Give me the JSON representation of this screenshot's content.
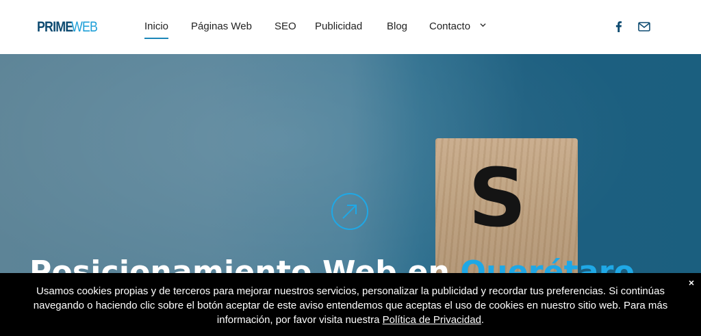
{
  "header": {
    "logo": {
      "prime": "PRIME",
      "web": "WEB"
    },
    "nav": [
      {
        "label": "Inicio",
        "active": true
      },
      {
        "label": "Páginas Web",
        "active": false
      },
      {
        "label": "SEO",
        "active": false
      },
      {
        "label": "Publicidad",
        "active": false
      },
      {
        "label": "Blog",
        "active": false
      },
      {
        "label": "Contacto",
        "active": false,
        "has_dropdown": true
      }
    ],
    "social": [
      {
        "icon": "facebook-icon"
      },
      {
        "icon": "mail-icon"
      }
    ]
  },
  "hero": {
    "title_main": "Posicionamiento Web en ",
    "title_accent": "Querétaro",
    "block_letter": "S",
    "icon": "arrow-up-right-circle-icon",
    "colors": {
      "accent": "#1fa8e6",
      "background": "#4a7f99"
    }
  },
  "cookie_bar": {
    "text": "Usamos cookies propias y de terceros para mejorar nuestros servicios, personalizar la publicidad y recordar tus preferencias. Si continúas navegando o haciendo clic sobre el botón aceptar de este aviso entendemos que aceptas el uso de cookies en nuestro sitio web. Para más información, por favor visita nuestra ",
    "link_text": "Política de Privacidad",
    "after_link": ".",
    "close_label": "×"
  },
  "colors": {
    "brand_dark": "#0d4a70",
    "brand_light": "#1fa0d8",
    "nav_underline": "#1b86b8"
  }
}
